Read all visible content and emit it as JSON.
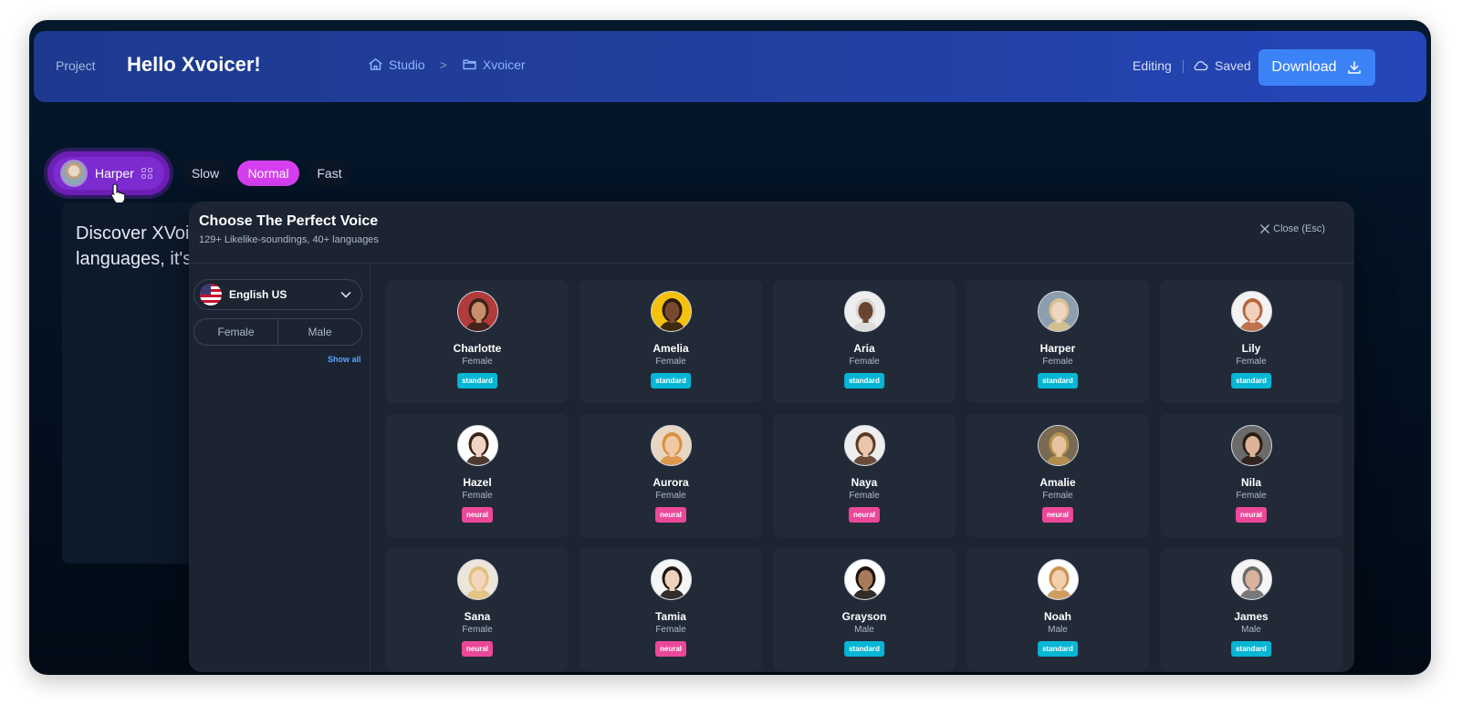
{
  "header": {
    "project_label": "Project",
    "title": "Hello Xvoicer!",
    "breadcrumb": [
      {
        "label": "Studio",
        "icon": "home-icon"
      },
      {
        "label": "Xvoicer",
        "icon": "folder-icon"
      }
    ],
    "breadcrumb_separator": ">",
    "status_editing": "Editing",
    "status_saved": "Saved",
    "download_label": "Download"
  },
  "toolbar": {
    "selected_voice": "Harper",
    "speeds": [
      "Slow",
      "Normal",
      "Fast"
    ],
    "active_speed": "Normal"
  },
  "editor": {
    "line1": "Discover XVoic",
    "line2": "languages, it's"
  },
  "modal": {
    "title": "Choose The Perfect Voice",
    "subtitle": "129+ Likelike-soundings, 40+ languages",
    "close_label": "Close (Esc)",
    "language": "English US",
    "gender_filters": [
      "Female",
      "Male"
    ],
    "show_all": "Show all",
    "badge_colors": {
      "standard": "#06b6d4",
      "neural": "#ec4899"
    },
    "voices": [
      {
        "name": "Charlotte",
        "gender": "Female",
        "type": "standard",
        "skin": "#c98e6b",
        "hair": "#3a2418",
        "bg": "#b13a3a"
      },
      {
        "name": "Amelia",
        "gender": "Female",
        "type": "standard",
        "skin": "#7a4a30",
        "hair": "#2a1a10",
        "bg": "#f4c20d"
      },
      {
        "name": "Aria",
        "gender": "Female",
        "type": "standard",
        "skin": "#6b4430",
        "hair": "#d9d9d9",
        "bg": "#eeeeee"
      },
      {
        "name": "Harper",
        "gender": "Female",
        "type": "standard",
        "skin": "#efd6c0",
        "hair": "#d9c28e",
        "bg": "#8d9eae"
      },
      {
        "name": "Lily",
        "gender": "Female",
        "type": "standard",
        "skin": "#f2d0bc",
        "hair": "#b8643c",
        "bg": "#f3f3f3"
      },
      {
        "name": "Hazel",
        "gender": "Female",
        "type": "neural",
        "skin": "#f1d5c4",
        "hair": "#3b2418",
        "bg": "#ffffff"
      },
      {
        "name": "Aurora",
        "gender": "Female",
        "type": "neural",
        "skin": "#f0c9a4",
        "hair": "#d9903e",
        "bg": "#e9d6c2"
      },
      {
        "name": "Naya",
        "gender": "Female",
        "type": "neural",
        "skin": "#e9c6ac",
        "hair": "#5a3b26",
        "bg": "#eeeeee"
      },
      {
        "name": "Amalie",
        "gender": "Female",
        "type": "neural",
        "skin": "#e5c3a0",
        "hair": "#b8924e",
        "bg": "#7a6a52"
      },
      {
        "name": "Nila",
        "gender": "Female",
        "type": "neural",
        "skin": "#dcb399",
        "hair": "#2b1d17",
        "bg": "#6b6b6b"
      },
      {
        "name": "Sana",
        "gender": "Female",
        "type": "neural",
        "skin": "#f3d6bd",
        "hair": "#e3c07a",
        "bg": "#ece5dc"
      },
      {
        "name": "Tamia",
        "gender": "Female",
        "type": "neural",
        "skin": "#efd3bf",
        "hair": "#1f1612",
        "bg": "#f5f5f5"
      },
      {
        "name": "Grayson",
        "gender": "Male",
        "type": "standard",
        "skin": "#a97a5a",
        "hair": "#1d1410",
        "bg": "#ffffff"
      },
      {
        "name": "Noah",
        "gender": "Male",
        "type": "standard",
        "skin": "#f3cfae",
        "hair": "#c99450",
        "bg": "#ffffff"
      },
      {
        "name": "James",
        "gender": "Male",
        "type": "standard",
        "skin": "#d9b39c",
        "hair": "#6a6a6a",
        "bg": "#f5f5f5"
      }
    ]
  }
}
